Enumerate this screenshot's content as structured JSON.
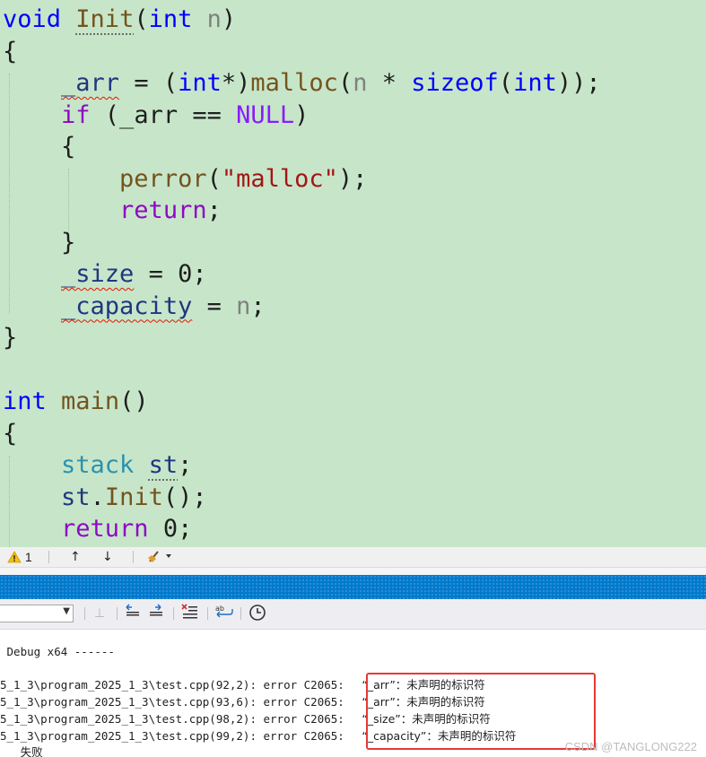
{
  "code": {
    "lines": [
      [
        [
          "kw",
          "void"
        ],
        [
          "plain",
          " "
        ],
        [
          "fn dots",
          "Init"
        ],
        [
          "plain",
          "("
        ],
        [
          "kw",
          "int"
        ],
        [
          "plain",
          " "
        ],
        [
          "param",
          "n"
        ],
        [
          "plain",
          ")"
        ]
      ],
      [
        [
          "plain",
          "{"
        ]
      ],
      [
        [
          "plain",
          "    "
        ],
        [
          "var squig",
          "_arr"
        ],
        [
          "plain",
          " = ("
        ],
        [
          "kw",
          "int"
        ],
        [
          "plain",
          "*)"
        ],
        [
          "fn",
          "malloc"
        ],
        [
          "plain",
          "("
        ],
        [
          "param",
          "n"
        ],
        [
          "plain",
          " * "
        ],
        [
          "kw",
          "sizeof"
        ],
        [
          "plain",
          "("
        ],
        [
          "kw",
          "int"
        ],
        [
          "plain",
          "));"
        ]
      ],
      [
        [
          "plain",
          "    "
        ],
        [
          "kw2",
          "if"
        ],
        [
          "plain",
          " (_arr == "
        ],
        [
          "macro",
          "NULL"
        ],
        [
          "plain",
          ")"
        ]
      ],
      [
        [
          "plain",
          "    {"
        ]
      ],
      [
        [
          "plain",
          "        "
        ],
        [
          "fn",
          "perror"
        ],
        [
          "plain",
          "("
        ],
        [
          "str",
          "\"malloc\""
        ],
        [
          "plain",
          ");"
        ]
      ],
      [
        [
          "plain",
          "        "
        ],
        [
          "kw2",
          "return"
        ],
        [
          "plain",
          ";"
        ]
      ],
      [
        [
          "plain",
          "    }"
        ]
      ],
      [
        [
          "plain",
          "    "
        ],
        [
          "var squig",
          "_size"
        ],
        [
          "plain",
          " = 0;"
        ]
      ],
      [
        [
          "plain",
          "    "
        ],
        [
          "var squig",
          "_capacity"
        ],
        [
          "plain",
          " = "
        ],
        [
          "param",
          "n"
        ],
        [
          "plain",
          ";"
        ]
      ],
      [
        [
          "plain",
          "}"
        ]
      ],
      [
        [
          "plain",
          ""
        ]
      ],
      [
        [
          "kw",
          "int"
        ],
        [
          "plain",
          " "
        ],
        [
          "fn",
          "main"
        ],
        [
          "plain",
          "()"
        ]
      ],
      [
        [
          "plain",
          "{"
        ]
      ],
      [
        [
          "plain",
          "    "
        ],
        [
          "typ",
          "stack"
        ],
        [
          "plain",
          " "
        ],
        [
          "var dots",
          "st"
        ],
        [
          "plain",
          ";"
        ]
      ],
      [
        [
          "plain",
          "    "
        ],
        [
          "var",
          "st"
        ],
        [
          "plain",
          "."
        ],
        [
          "fn",
          "Init"
        ],
        [
          "plain",
          "();"
        ]
      ],
      [
        [
          "plain",
          "    "
        ],
        [
          "kw2",
          "return"
        ],
        [
          "plain",
          " 0;"
        ]
      ]
    ]
  },
  "status_bar": {
    "warning_count": "1",
    "warning_icon": "warning-triangle-icon",
    "nav_up_icon": "arrow-up-icon",
    "nav_down_icon": "arrow-down-icon",
    "cleanup_icon": "broom-icon"
  },
  "colors": {
    "editor_bg": "#c7e6c9",
    "panel_title_bg": "#007acc",
    "highlight_border": "#e53935"
  },
  "output": {
    "header": " Debug x64 ------",
    "errors": [
      {
        "path": "5_1_3\\program_2025_1_3\\test.cpp(92,2): error C2065: ",
        "message": "“_arr”：未声明的标识符"
      },
      {
        "path": "5_1_3\\program_2025_1_3\\test.cpp(93,6): error C2065: ",
        "message": "“_arr”：未声明的标识符"
      },
      {
        "path": "5_1_3\\program_2025_1_3\\test.cpp(98,2): error C2065: ",
        "message": "“_size”：未声明的标识符"
      },
      {
        "path": "5_1_3\\program_2025_1_3\\test.cpp(99,2): error C2065: ",
        "message": "“_capacity”：未声明的标识符"
      }
    ],
    "trailing": "   失败"
  },
  "watermark": "CSDN @TANGLONG222"
}
